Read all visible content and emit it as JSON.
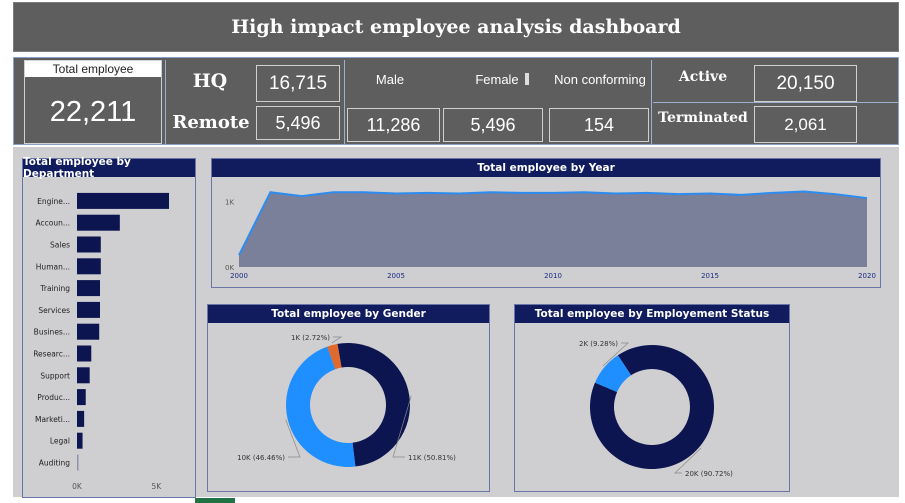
{
  "header": {
    "title": "High impact employee analysis dashboard"
  },
  "kpis": {
    "total_label": "Total employee",
    "total_value": "22,211",
    "hq_label": "HQ",
    "hq_value": "16,715",
    "remote_label": "Remote",
    "remote_value": "5,496",
    "male_label": "Male",
    "male_value": "11,286",
    "female_label": "Female",
    "female_value": "5,496",
    "nonconf_label": "Non conforming",
    "nonconf_value": "154",
    "active_label": "Active",
    "active_value": "20,150",
    "terminated_label": "Terminated",
    "terminated_value": "2,061"
  },
  "colors": {
    "navy": "#0d1550",
    "blue": "#1f8fff",
    "orange": "#e06a2e",
    "area": "#7a7f9a",
    "line": "#2d8cf0"
  },
  "chart_data": [
    {
      "type": "bar",
      "title": "Total employee by Department",
      "orientation": "horizontal",
      "categories": [
        "Engine...",
        "Accoun...",
        "Sales",
        "Human...",
        "Training",
        "Services",
        "Busines...",
        "Researc...",
        "Support",
        "Produc...",
        "Marketi...",
        "Legal",
        "Auditing"
      ],
      "values": [
        5800,
        2700,
        1500,
        1500,
        1450,
        1450,
        1400,
        900,
        800,
        550,
        450,
        350,
        60
      ],
      "xlim": [
        0,
        5800
      ],
      "xticks": [
        {
          "v": 0,
          "label": "0K"
        },
        {
          "v": 5000,
          "label": "5K"
        }
      ]
    },
    {
      "type": "area",
      "title": "Total employee by Year",
      "x": [
        2000,
        2001,
        2002,
        2003,
        2004,
        2005,
        2006,
        2007,
        2008,
        2009,
        2010,
        2011,
        2012,
        2013,
        2014,
        2015,
        2016,
        2017,
        2018,
        2019,
        2020
      ],
      "values": [
        180,
        1140,
        1080,
        1140,
        1140,
        1120,
        1130,
        1120,
        1140,
        1130,
        1130,
        1140,
        1120,
        1130,
        1110,
        1120,
        1100,
        1130,
        1150,
        1110,
        1050
      ],
      "ylim": [
        0,
        1250
      ],
      "yticks": [
        {
          "v": 0,
          "label": "0K"
        },
        {
          "v": 1000,
          "label": "1K"
        }
      ],
      "xticks": [
        2000,
        2005,
        2010,
        2015,
        2020
      ]
    },
    {
      "type": "pie",
      "title": "Total employee by Gender",
      "slices": [
        {
          "value": 50.81,
          "label": "11K (50.81%)",
          "color": "#0d1550"
        },
        {
          "value": 46.46,
          "label": "10K (46.46%)",
          "color": "#1f8fff"
        },
        {
          "value": 2.72,
          "label": "1K (2.72%)",
          "color": "#e06a2e"
        }
      ]
    },
    {
      "type": "pie",
      "title": "Total employee by Employement Status",
      "slices": [
        {
          "value": 90.72,
          "label": "20K (90.72%)",
          "color": "#0d1550"
        },
        {
          "value": 9.28,
          "label": "2K (9.28%)",
          "color": "#1f8fff"
        }
      ]
    }
  ]
}
